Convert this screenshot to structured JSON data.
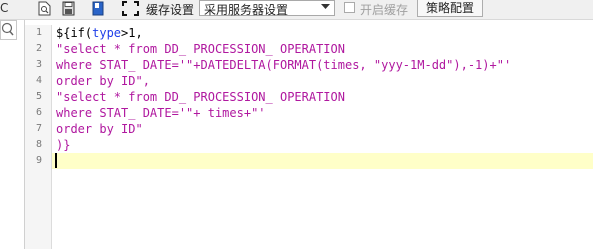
{
  "toolbar": {
    "cache_settings_label": "缓存设置",
    "server_select_value": "采用服务器设置",
    "open_cache_label": "开启缓存",
    "policy_button_label": "策略配置",
    "icons": [
      "caret-icon",
      "file-icon",
      "save-icon",
      "bookmark-icon",
      "fullscreen-icon",
      "chevron-down-icon"
    ]
  },
  "left_panel": {
    "icons": [
      "search-icon"
    ]
  },
  "editor": {
    "line_numbers": [
      "1",
      "2",
      "3",
      "4",
      "5",
      "6",
      "7",
      "8",
      "9"
    ],
    "lines": [
      [
        {
          "t": "${if(",
          "c": "plain"
        },
        {
          "t": "type",
          "c": "kw"
        },
        {
          "t": ">1,",
          "c": "plain"
        }
      ],
      [
        {
          "t": "\"select * from DD_ PROCESSION_ OPERATION",
          "c": "str"
        }
      ],
      [
        {
          "t": "where STAT_ DATE='\"+DATEDELTA(FORMAT(times, ",
          "c": "str"
        },
        {
          "t": "\"yyy-1M-dd\"",
          "c": "str"
        },
        {
          "t": "),-1)+\"'",
          "c": "str"
        }
      ],
      [
        {
          "t": "order by ID\",",
          "c": "str"
        }
      ],
      [
        {
          "t": "\"select * from DD_ PROCESSION_ OPERATION",
          "c": "str"
        }
      ],
      [
        {
          "t": "where STAT_ DATE='\"+ times+\"'",
          "c": "str"
        }
      ],
      [
        {
          "t": "order by ID\"",
          "c": "str"
        }
      ],
      [
        {
          "t": ")}",
          "c": "str"
        }
      ],
      []
    ],
    "current_line": 9,
    "colors": {
      "string": "#b0189f",
      "keyword": "#1f3fe8",
      "highlight": "#ffffc8"
    }
  }
}
